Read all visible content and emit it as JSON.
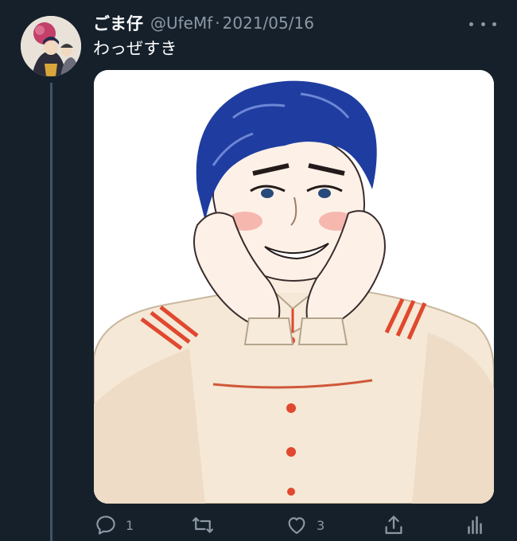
{
  "tweet": {
    "display_name": "ごま仔",
    "handle": "@UfeMf",
    "separator": "·",
    "date": "2021/05/16",
    "text": "わっぜすき"
  },
  "actions": {
    "reply_count": "1",
    "like_count": "3"
  },
  "icons": [
    "more-icon",
    "reply-icon",
    "retweet-icon",
    "like-icon",
    "share-icon",
    "analytics-icon"
  ],
  "colors": {
    "background": "#15202b",
    "secondary_text": "#8b98a5",
    "thread_line": "#3d5466"
  }
}
